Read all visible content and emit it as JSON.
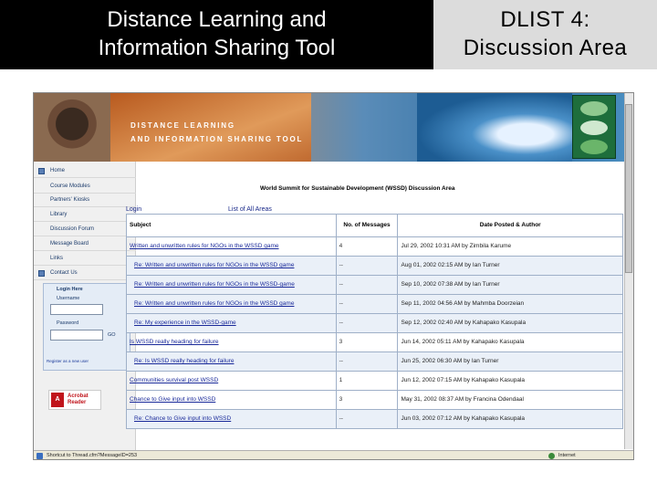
{
  "slide": {
    "title_left_line1": "Distance Learning and",
    "title_left_line2": "Information Sharing Tool",
    "title_right_line1": "DLIST 4:",
    "title_right_line2": "Discussion Area"
  },
  "banner": {
    "line1": "DISTANCE LEARNING",
    "line2": "AND INFORMATION SHARING TOOL"
  },
  "nav": {
    "items": [
      {
        "label": "Home"
      },
      {
        "label": "Course Modules"
      },
      {
        "label": "Partners' Kiosks"
      },
      {
        "label": "Library"
      },
      {
        "label": "Discussion Forum"
      },
      {
        "label": "Message Board"
      },
      {
        "label": "Links"
      },
      {
        "label": "Contact Us"
      }
    ],
    "login_title": "Login Here",
    "username_label": "Username",
    "password_label": "Password",
    "go_label": "GO",
    "register_text": "Register as a new user"
  },
  "acrobat": {
    "brand": "Acrobat",
    "product": "Reader",
    "logo_text": "A"
  },
  "main": {
    "heading": "World Summit for Sustainable Development (WSSD) Discussion Area",
    "login_link": "Login",
    "list_link": "List of All Areas",
    "columns": [
      "Subject",
      "No. of Messages",
      "Date Posted & Author"
    ],
    "rows": [
      {
        "subject": "Written and unwritten rules for NGOs in the WSSD game",
        "count": "4",
        "date": "Jul 29, 2002 10:31 AM by Zimbila Karume",
        "reply": false
      },
      {
        "subject": "Re: Written and unwritten rules for NGOs in the WSSD game",
        "count": "--",
        "date": "Aug 01, 2002 02:15 AM by Ian Turner",
        "reply": true
      },
      {
        "subject": "Re: Written and unwritten rules for NGOs in the WSSD-game",
        "count": "--",
        "date": "Sep 10, 2002 07:38 AM by Ian Turner",
        "reply": true
      },
      {
        "subject": "Re: Written and unwritten rules for NGOs in the WSSD game",
        "count": "--",
        "date": "Sep 11, 2002 04:56 AM by Mahmba Doorzeian",
        "reply": true
      },
      {
        "subject": "Re: My experience in the WSSD-game",
        "count": "--",
        "date": "Sep 12, 2002 02:40 AM by Kahapako Kasupala",
        "reply": true
      },
      {
        "subject": "Is WSSD really heading for failure",
        "count": "3",
        "date": "Jun 14, 2002 05:11 AM by Kahapako Kasupala",
        "reply": false
      },
      {
        "subject": "Re: Is WSSD really heading for failure",
        "count": "--",
        "date": "Jun 25, 2002 06:30 AM by Ian Turner",
        "reply": true
      },
      {
        "subject": "Communities survival post WSSD",
        "count": "1",
        "date": "Jun 12, 2002 07:15 AM by Kahapako Kasupala",
        "reply": false
      },
      {
        "subject": "Chance to Give input into WSSD",
        "count": "3",
        "date": "May 31, 2002 08:37 AM by Francina Odendaal",
        "reply": false
      },
      {
        "subject": "Re: Chance to Give input into WSSD",
        "count": "--",
        "date": "Jun 03, 2002 07:12 AM by Kahapako Kasupala",
        "reply": true
      }
    ]
  },
  "status": {
    "url": "Shortcut to Thread.cfm?MessageID=253",
    "zone": "Internet"
  }
}
